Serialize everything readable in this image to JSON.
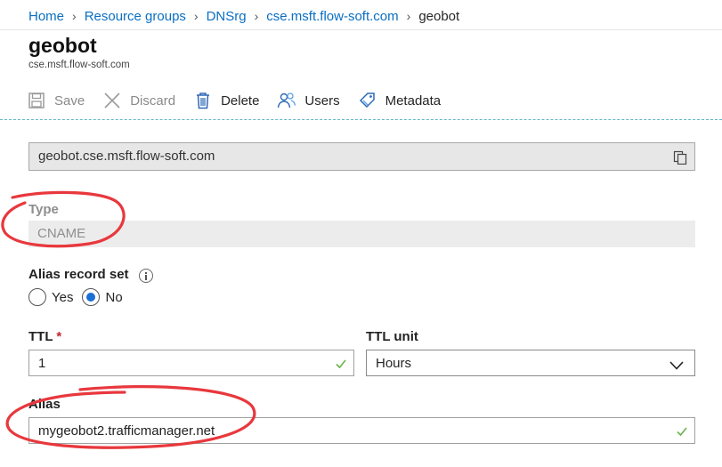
{
  "breadcrumb": {
    "items": [
      "Home",
      "Resource groups",
      "DNSrg",
      "cse.msft.flow-soft.com"
    ],
    "current": "geobot"
  },
  "header": {
    "title": "geobot",
    "subtitle": "cse.msft.flow-soft.com"
  },
  "toolbar": {
    "save_label": "Save",
    "discard_label": "Discard",
    "delete_label": "Delete",
    "users_label": "Users",
    "metadata_label": "Metadata"
  },
  "form": {
    "name_value": "geobot.cse.msft.flow-soft.com",
    "type_label": "Type",
    "type_value": "CNAME",
    "alias_record_label": "Alias record set",
    "alias_record_options": [
      "Yes",
      "No"
    ],
    "alias_record_selected": "No",
    "ttl_label": "TTL",
    "ttl_required_marker": "*",
    "ttl_value": "1",
    "ttl_unit_label": "TTL unit",
    "ttl_unit_value": "Hours",
    "alias_label": "Alias",
    "alias_value": "mygeobot2.trafficmanager.net"
  },
  "colors": {
    "link": "#0a6fc2",
    "annotation_red": "#e8383d",
    "valid_check": "#6bb34a",
    "radio_selected": "#1a6fd6"
  }
}
